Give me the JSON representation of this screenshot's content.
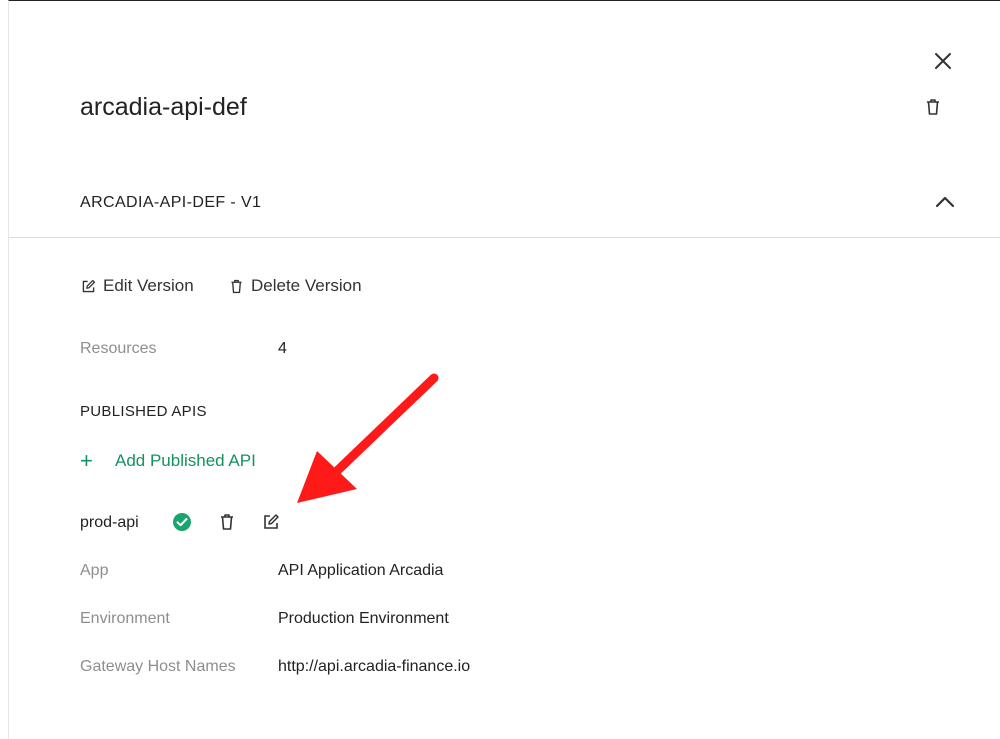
{
  "header": {
    "title": "arcadia-api-def"
  },
  "version": {
    "title": "ARCADIA-API-DEF - V1",
    "edit_label": "Edit Version",
    "delete_label": "Delete Version",
    "resources_label": "Resources",
    "resources_value": "4"
  },
  "published": {
    "section_title": "PUBLISHED APIS",
    "add_label": "Add Published API",
    "api": {
      "name": "prod-api",
      "fields": [
        {
          "label": "App",
          "value": "API Application Arcadia"
        },
        {
          "label": "Environment",
          "value": "Production Environment"
        },
        {
          "label": "Gateway Host Names",
          "value": "http://api.arcadia-finance.io"
        }
      ]
    }
  },
  "colors": {
    "accent": "#14925f",
    "status_ok": "#1aa56e",
    "annotation_arrow": "#ff1a1a"
  },
  "icons": [
    "close-icon",
    "trash-icon",
    "chevron-up-icon",
    "edit-icon",
    "check-circle-icon",
    "plus-icon"
  ]
}
